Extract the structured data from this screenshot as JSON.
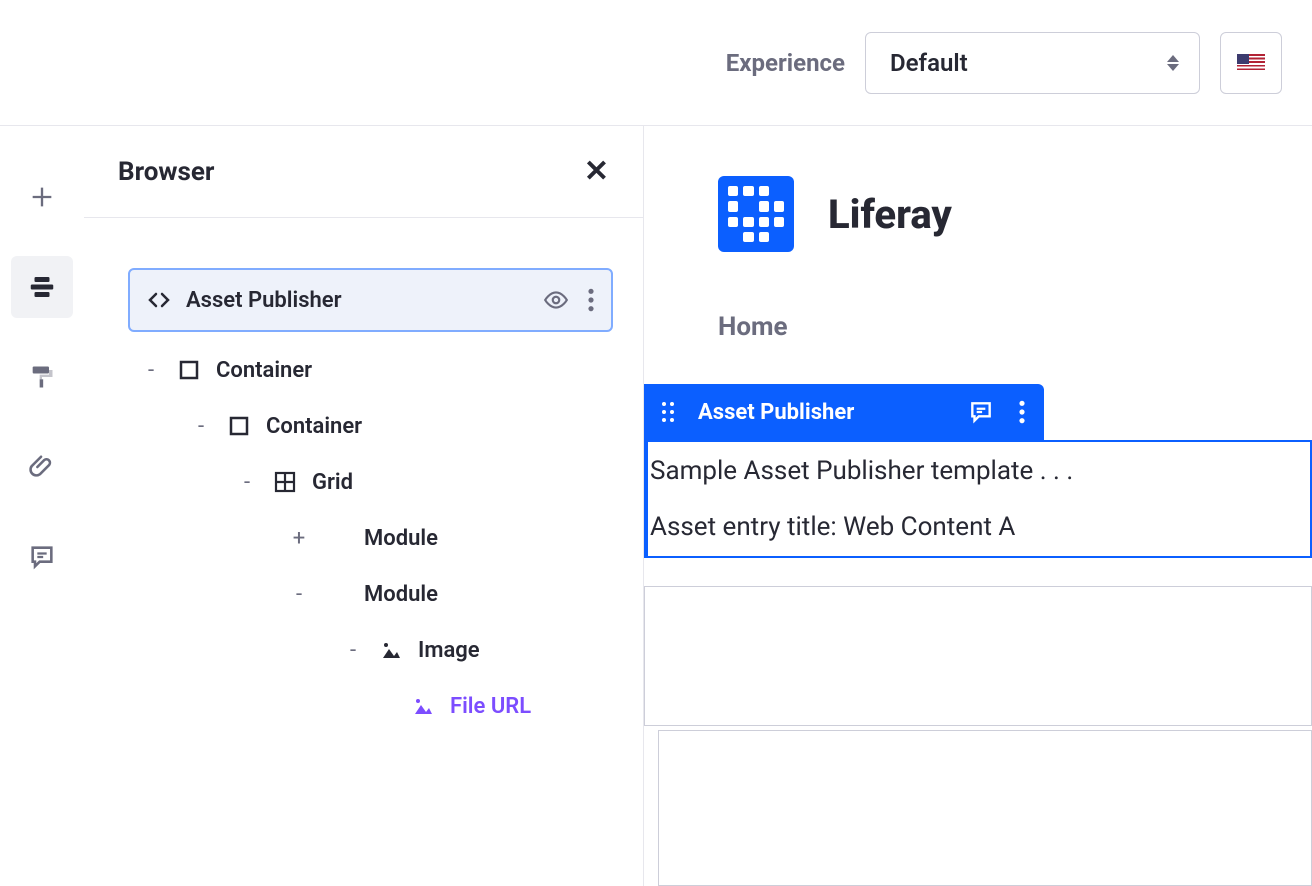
{
  "topbar": {
    "experience_label": "Experience",
    "experience_value": "Default",
    "locale_flag": "us"
  },
  "leftRail": {
    "items": [
      "add",
      "browser",
      "design",
      "attachments",
      "comments"
    ],
    "activeIndex": 1
  },
  "browser": {
    "title": "Browser",
    "tree": [
      {
        "id": "asset-publisher",
        "label": "Asset Publisher",
        "icon": "code",
        "selected": true,
        "indent": 1,
        "toggle": ""
      },
      {
        "id": "container-1",
        "label": "Container",
        "icon": "square",
        "indent": 1,
        "toggle": "-"
      },
      {
        "id": "container-2",
        "label": "Container",
        "icon": "square",
        "indent": 2,
        "toggle": "-"
      },
      {
        "id": "grid",
        "label": "Grid",
        "icon": "grid",
        "indent": 3,
        "toggle": "-"
      },
      {
        "id": "module-1",
        "label": "Module",
        "icon": "",
        "indent": 4,
        "toggle": "+"
      },
      {
        "id": "module-2",
        "label": "Module",
        "icon": "",
        "indent": 4,
        "toggle": "-"
      },
      {
        "id": "image",
        "label": "Image",
        "icon": "image",
        "indent": 5,
        "toggle": "-"
      },
      {
        "id": "file-url",
        "label": "File URL",
        "icon": "image-link",
        "indent": 6,
        "toggle": "",
        "link": true
      }
    ]
  },
  "canvas": {
    "brand": "Liferay",
    "nav_home": "Home",
    "widget": {
      "title": "Asset Publisher",
      "line1": "Sample Asset Publisher template . . .",
      "line2": "Asset entry title: Web Content A"
    }
  }
}
